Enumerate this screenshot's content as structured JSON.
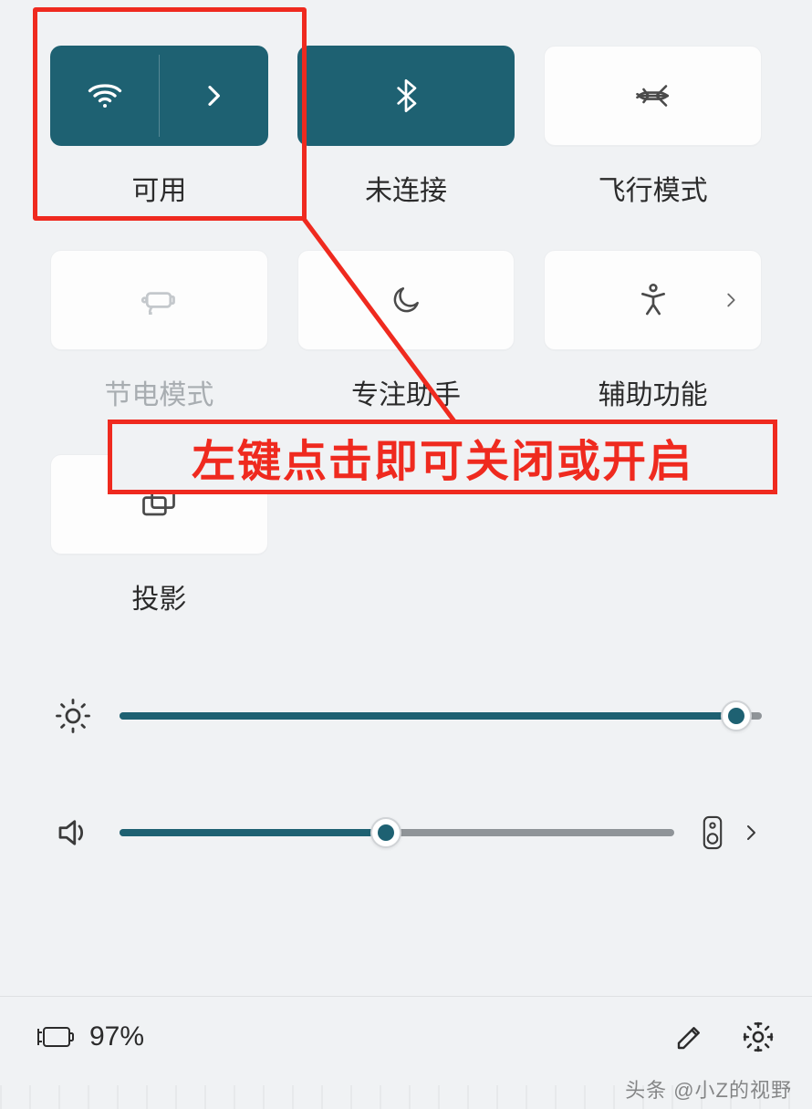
{
  "tiles": {
    "wifi": {
      "label": "可用",
      "active": true
    },
    "bluetooth": {
      "label": "未连接",
      "active": true
    },
    "airplane": {
      "label": "飞行模式",
      "active": false
    },
    "battery_saver": {
      "label": "节电模式",
      "active": false,
      "disabled": true
    },
    "focus_assist": {
      "label": "专注助手",
      "active": false
    },
    "accessibility": {
      "label": "辅助功能",
      "active": false
    },
    "project": {
      "label": "投影",
      "active": false
    }
  },
  "annotation": {
    "text": "左键点击即可关闭或开启"
  },
  "sliders": {
    "brightness_percent": 96,
    "volume_percent": 48
  },
  "footer": {
    "battery_text": "97%"
  },
  "watermark": "头条 @小Z的视野",
  "colors": {
    "accent": "#1e6172",
    "annotation": "#ef2a1f"
  }
}
